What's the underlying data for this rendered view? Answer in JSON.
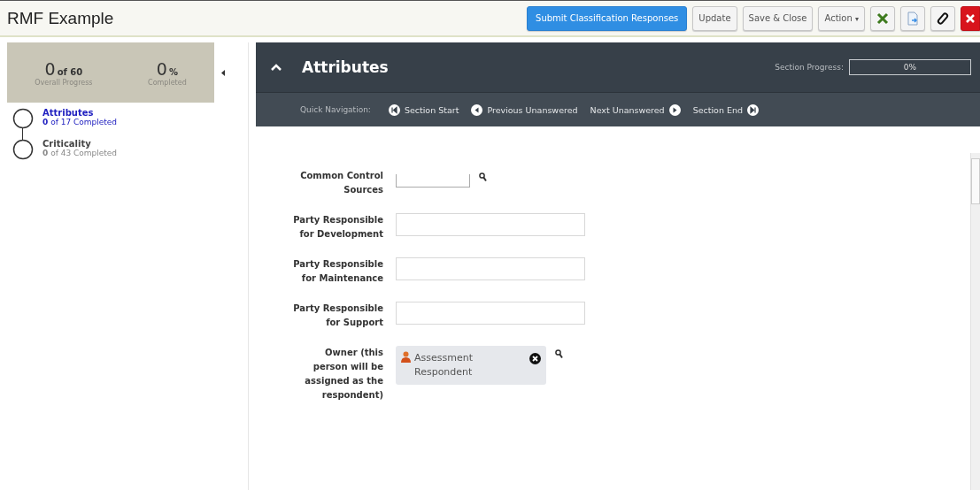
{
  "window": {
    "title": "RMF Example"
  },
  "toolbar": {
    "buttons": [
      {
        "label": "Submit Classification Responses",
        "kind": "primary"
      },
      {
        "label": "Update",
        "kind": "plain"
      },
      {
        "label": "Save & Close",
        "kind": "plain"
      },
      {
        "label": "Action",
        "kind": "menu",
        "caret": "▾"
      },
      {
        "kind": "excel"
      },
      {
        "kind": "export"
      },
      {
        "kind": "attach"
      },
      {
        "kind": "close"
      }
    ]
  },
  "progress": {
    "count": "0",
    "count_suffix": "of 60",
    "count_label": "Overall Progress",
    "percent": "0",
    "percent_suffix": "%",
    "percent_label": "Completed"
  },
  "sections": [
    {
      "name": "Attributes",
      "count": "0",
      "status": "of 17 Completed",
      "selected": true
    },
    {
      "name": "Criticality",
      "count": "0",
      "status": "of 43 Completed",
      "selected": false
    }
  ],
  "section_header": {
    "title": "Attributes",
    "expanded": true,
    "progress_label": "Section Progress:",
    "progress_value": "0%",
    "level": 0
  },
  "quick_nav": {
    "label": "Quick Navigation:",
    "links": [
      {
        "label": "Section Start",
        "kind": "first"
      },
      {
        "label": "Previous Unanswered",
        "kind": "prev"
      },
      {
        "label": "Next Unanswered",
        "kind": "next"
      },
      {
        "label": "Section End",
        "kind": "last"
      }
    ]
  },
  "fields": [
    {
      "label": "Common Control Sources",
      "kind": "lookup"
    },
    {
      "label": "Party Responsible for Development",
      "kind": "text"
    },
    {
      "label": "Party Responsible for Maintenance",
      "kind": "text"
    },
    {
      "label": "Party Responsible for Support",
      "kind": "text"
    },
    {
      "label": "Owner (this person will be assigned as the respondent)",
      "kind": "user",
      "value": "Assessment Respondent"
    }
  ]
}
